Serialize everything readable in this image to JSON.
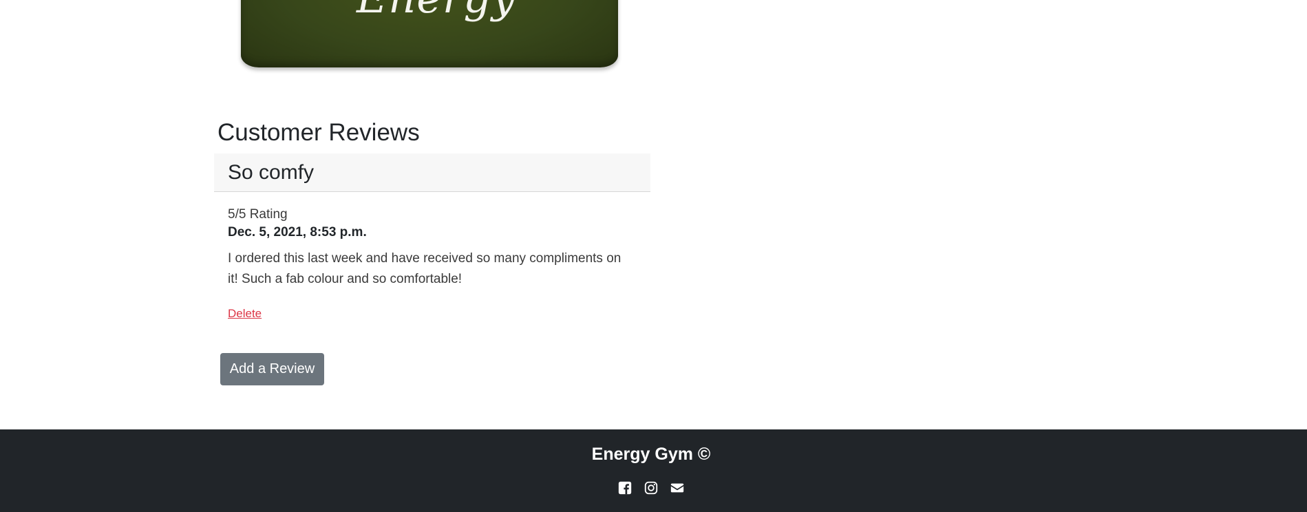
{
  "product": {
    "image_text": "Energy"
  },
  "reviews": {
    "heading": "Customer Reviews",
    "items": [
      {
        "title": "So comfy",
        "rating": "5/5 Rating",
        "date": "Dec. 5, 2021, 8:53 p.m.",
        "text": "I ordered this last week and have received so many compliments on it! Such a fab colour and so comfortable!",
        "delete_label": "Delete"
      }
    ],
    "add_button_label": "Add a Review"
  },
  "footer": {
    "title": "Energy Gym ©",
    "icons": [
      "facebook-icon",
      "instagram-icon",
      "envelope-icon"
    ]
  },
  "colors": {
    "product_green": "#37461a",
    "footer_bg": "#212529",
    "button_bg": "#6c757d",
    "delete_link": "#dc3545",
    "card_header_bg": "#f7f7f7"
  }
}
